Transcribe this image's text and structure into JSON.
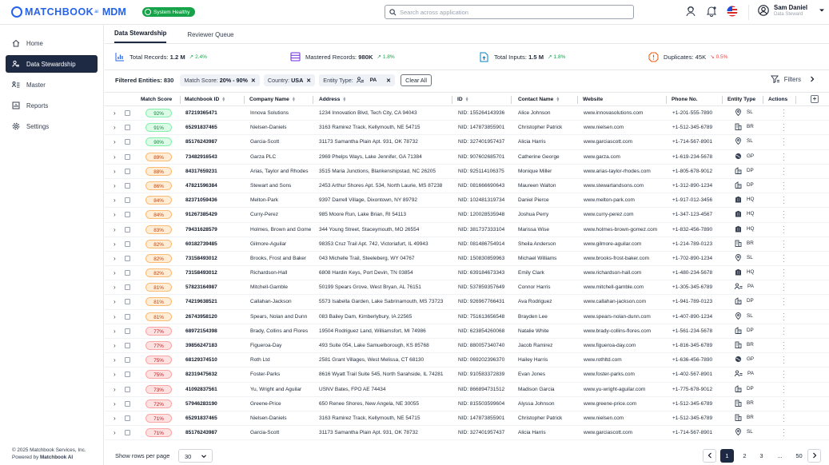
{
  "app": {
    "brand": "MATCHBOOK",
    "brand_ai": "ai",
    "brand_mdm": "MDM",
    "health_badge": "System Healthy",
    "search_placeholder": "Search across application",
    "user_name": "Sam Daniel",
    "user_role": "Data Steward"
  },
  "sidebar": {
    "items": [
      {
        "label": "Home",
        "icon": "home-icon"
      },
      {
        "label": "Data Stewardship",
        "icon": "users-icon"
      },
      {
        "label": "Master",
        "icon": "hierarchy-icon"
      },
      {
        "label": "Reports",
        "icon": "chart-icon"
      },
      {
        "label": "Settings",
        "icon": "gear-icon"
      }
    ],
    "footer_line1": "© 2025 Matchbook Services, Inc.",
    "footer_line2_prefix": "Powered by ",
    "footer_line2_brand": "Matchbook AI"
  },
  "tabs": [
    "Data Stewardship",
    "Reviewer Queue"
  ],
  "stats": {
    "total_records_label": "Total Records:",
    "total_records_value": "1.2 M",
    "total_records_trend": "2.4%",
    "mastered_label": "Mastered Records:",
    "mastered_value": "980K",
    "mastered_trend": "1.8%",
    "inputs_label": "Total Inputs:",
    "inputs_value": "1.5 M",
    "inputs_trend": "1.8%",
    "duplicates_label": "Duplicates: 45K",
    "duplicates_trend": "0.5%"
  },
  "filters": {
    "label": "Filtered Entities: 830",
    "chip1_label": "Match Score:",
    "chip1_value": "20% - 90%",
    "chip2_label": "Country:",
    "chip2_value": "USA",
    "chip3_label": "Entity Type:",
    "chip3_value": "PA",
    "clear_all": "Clear All",
    "filters_button": "Filters"
  },
  "columns": [
    "Match Score",
    "Matchbook ID",
    "Company Name",
    "Address",
    "ID",
    "Contact Name",
    "Website",
    "Phone No.",
    "Entity Type",
    "Actions"
  ],
  "rows": [
    {
      "score": "92%",
      "tier": "green",
      "mbid": "87219365471",
      "company": "Innova Solutions",
      "address": "1234 Innovation Blvd, Tech City, CA 94043",
      "id": "NID: 155264143936",
      "contact": "Alice Johnson",
      "website": "www.innovasolutions.com",
      "phone": "+1-201-555-7890",
      "etype": "SL"
    },
    {
      "score": "91%",
      "tier": "green",
      "mbid": "65291837465",
      "company": "Nielsen-Daniels",
      "address": "3163 Ramirez Track, Kellymouth, NE 54715",
      "id": "NID: 147873855901",
      "contact": "Christopher Patrick",
      "website": "www.nielsen.com",
      "phone": "+1-512-345-6789",
      "etype": "BR"
    },
    {
      "score": "90%",
      "tier": "green",
      "mbid": "85176243987",
      "company": "Garcia-Scott",
      "address": "31173 Samantha Plain Apt. 931, OK 78732",
      "id": "NID: 327401957437",
      "contact": "Alicia Harris",
      "website": "www.garciascott.com",
      "phone": "+1-714-567-8901",
      "etype": "SL"
    },
    {
      "score": "89%",
      "tier": "orange",
      "mbid": "73482916543",
      "company": "Garza PLC",
      "address": "2969 Phelps Ways, Lake Jennifer, GA 71384",
      "id": "NID: 907602685701",
      "contact": "Catherine George",
      "website": "www.garza.com",
      "phone": "+1-619-234-5678",
      "etype": "GP"
    },
    {
      "score": "88%",
      "tier": "orange",
      "mbid": "84317659231",
      "company": "Arias, Taylor and Rhodes",
      "address": "3515 Maria Junctions, Blankenshipstad, NC 26205",
      "id": "NID: 925114106375",
      "contact": "Monique Miller",
      "website": "www.arias-taylor-rhodes.com",
      "phone": "+1-805-678-9012",
      "etype": "DP"
    },
    {
      "score": "86%",
      "tier": "orange",
      "mbid": "47821596384",
      "company": "Stewart and Sons",
      "address": "2453 Arthur Shores Apt. 534, North Laurie, MS 87238",
      "id": "NID: 081666690643",
      "contact": "Maureen Walton",
      "website": "www.stewartandsons.com",
      "phone": "+1-312-890-1234",
      "etype": "DP"
    },
    {
      "score": "84%",
      "tier": "orange",
      "mbid": "82371059436",
      "company": "Melton-Park",
      "address": "9397 Darrell Village, Dixontown, NY 89792",
      "id": "NID: 102481319734",
      "contact": "Daniel Pierce",
      "website": "www.melton-park.com",
      "phone": "+1-917-012-3456",
      "etype": "HQ"
    },
    {
      "score": "84%",
      "tier": "orange",
      "mbid": "91267385429",
      "company": "Curry-Perez",
      "address": "985 Moore Run, Lake Brian, RI 54113",
      "id": "NID: 120028535948",
      "contact": "Joshua Perry",
      "website": "www.curry-perez.com",
      "phone": "+1-347-123-4567",
      "etype": "HQ"
    },
    {
      "score": "83%",
      "tier": "orange",
      "mbid": "79431628579",
      "company": "Holmes, Brown and Gomez",
      "address": "344 Young Street, Staceymouth, MO 26554",
      "id": "NID: 381737333104",
      "contact": "Marissa Wise",
      "website": "www.holmes-brown-gomez.com",
      "phone": "+1-832-456-7890",
      "etype": "HQ"
    },
    {
      "score": "82%",
      "tier": "orange",
      "mbid": "60182739485",
      "company": "Gilmore-Aguilar",
      "address": "98353 Cruz Trail Apt. 742, Victoriafurt, IL 49943",
      "id": "NID: 081486754914",
      "contact": "Sheila Anderson",
      "website": "www.gilmore-aguilar.com",
      "phone": "+1-214-789-0123",
      "etype": "BR"
    },
    {
      "score": "82%",
      "tier": "orange",
      "mbid": "73158493012",
      "company": "Brooks, Frost and Baker",
      "address": "043 Michelle Trail, Steeleberg, WY 04767",
      "id": "NID: 150830859963",
      "contact": "Michael Williams",
      "website": "www.brooks-frost-baker.com",
      "phone": "+1-702-890-1234",
      "etype": "SL"
    },
    {
      "score": "82%",
      "tier": "orange",
      "mbid": "73158493012",
      "company": "Richardson-Hall",
      "address": "6808 Hardin Keys, Port Devin, TN 03854",
      "id": "NID: 639184673343",
      "contact": "Emily Clark",
      "website": "www.richardson-hall.com",
      "phone": "+1-480-234-5678",
      "etype": "HQ"
    },
    {
      "score": "81%",
      "tier": "orange",
      "mbid": "57823164987",
      "company": "Mitchell-Gamble",
      "address": "50199 Spears Grove, West Bryan, AL 76151",
      "id": "NID: 537859357649",
      "contact": "Connor Harris",
      "website": "www.mitchell-gamble.com",
      "phone": "+1-305-345-6789",
      "etype": "PA"
    },
    {
      "score": "81%",
      "tier": "orange",
      "mbid": "74219638521",
      "company": "Callahan-Jackson",
      "address": "5573 Isabella Garden, Lake Sabrinamouth, MS 73723",
      "id": "NID: 926967766431",
      "contact": "Ava Rodriguez",
      "website": "www.callahan-jackson.com",
      "phone": "+1-941-789-0123",
      "etype": "DP"
    },
    {
      "score": "81%",
      "tier": "orange",
      "mbid": "26743958120",
      "company": "Spears, Nolan and Dunn",
      "address": "083 Bailey Dam, Kimberlybury, IA 22565",
      "id": "NID: 751613656548",
      "contact": "Brayden Lee",
      "website": "www.spears-nolan-dunn.com",
      "phone": "+1-407-890-1234",
      "etype": "SL"
    },
    {
      "score": "77%",
      "tier": "red",
      "mbid": "68972154398",
      "company": "Brady, Collins and Flores",
      "address": "19504 Rodriguez Land, Williamsfort, MI 74986",
      "id": "NID: 623854260068",
      "contact": "Natalie White",
      "website": "www.brady-collins-flores.com",
      "phone": "+1-561-234-5678",
      "etype": "DP"
    },
    {
      "score": "77%",
      "tier": "red",
      "mbid": "39856247183",
      "company": "Figueroa-Day",
      "address": "493 Suite 054, Lake Samuelborough, KS 85768",
      "id": "NID: 880057340740",
      "contact": "Jacob Ramirez",
      "website": "www.figueroa-day.com",
      "phone": "+1-816-345-6789",
      "etype": "BR"
    },
    {
      "score": "75%",
      "tier": "red",
      "mbid": "68129374510",
      "company": "Roth Ltd",
      "address": "2581 Grant Villages, West Melissa, CT 68130",
      "id": "NID: 069202396370",
      "contact": "Hailey Harris",
      "website": "www.rothltd.com",
      "phone": "+1-636-456-7890",
      "etype": "GP"
    },
    {
      "score": "75%",
      "tier": "red",
      "mbid": "82319475632",
      "company": "Foster-Parks",
      "address": "8616 Wyatt Trail Suite 545, North Sarahside, IL 74281",
      "id": "NID: 910583372839",
      "contact": "Evan Jones",
      "website": "www.foster-parks.com",
      "phone": "+1-402-567-8901",
      "etype": "PA"
    },
    {
      "score": "73%",
      "tier": "red",
      "mbid": "41092837561",
      "company": "Yu, Wright and Aguilar",
      "address": "USNV Bates, FPO AE 74434",
      "id": "NID: 866894731512",
      "contact": "Madison Garcia",
      "website": "www.yu-wright-aguilar.com",
      "phone": "+1-775-678-9012",
      "etype": "DP"
    },
    {
      "score": "72%",
      "tier": "red",
      "mbid": "57946283190",
      "company": "Greene-Price",
      "address": "650 Renee Shores, New Angela, NE 30055",
      "id": "NID: 815503599604",
      "contact": "Alyssa Johnson",
      "website": "www.greene-price.com",
      "phone": "+1-512-345-6789",
      "etype": "BR"
    },
    {
      "score": "71%",
      "tier": "red",
      "mbid": "65291837465",
      "company": "Nielsen-Daniels",
      "address": "3163 Ramirez Track, Kellymouth, NE 54715",
      "id": "NID: 147873855901",
      "contact": "Christopher Patrick",
      "website": "www.nielsen.com",
      "phone": "+1-512-345-6789",
      "etype": "BR"
    },
    {
      "score": "71%",
      "tier": "red",
      "mbid": "85176243987",
      "company": "Garcia-Scott",
      "address": "31173 Samantha Plain Apt. 931, OK 78732",
      "id": "NID: 327401957437",
      "contact": "Alicia Harris",
      "website": "www.garciascott.com",
      "phone": "+1-714-567-8901",
      "etype": "SL"
    }
  ],
  "pager": {
    "rows_label": "Show rows per page",
    "rows_value": "30",
    "pages": [
      "1",
      "2",
      "3",
      "...",
      "50"
    ]
  },
  "colors": {
    "accent": "#2563eb",
    "nav_active": "#1e2a44",
    "healthy": "#16a34a"
  }
}
